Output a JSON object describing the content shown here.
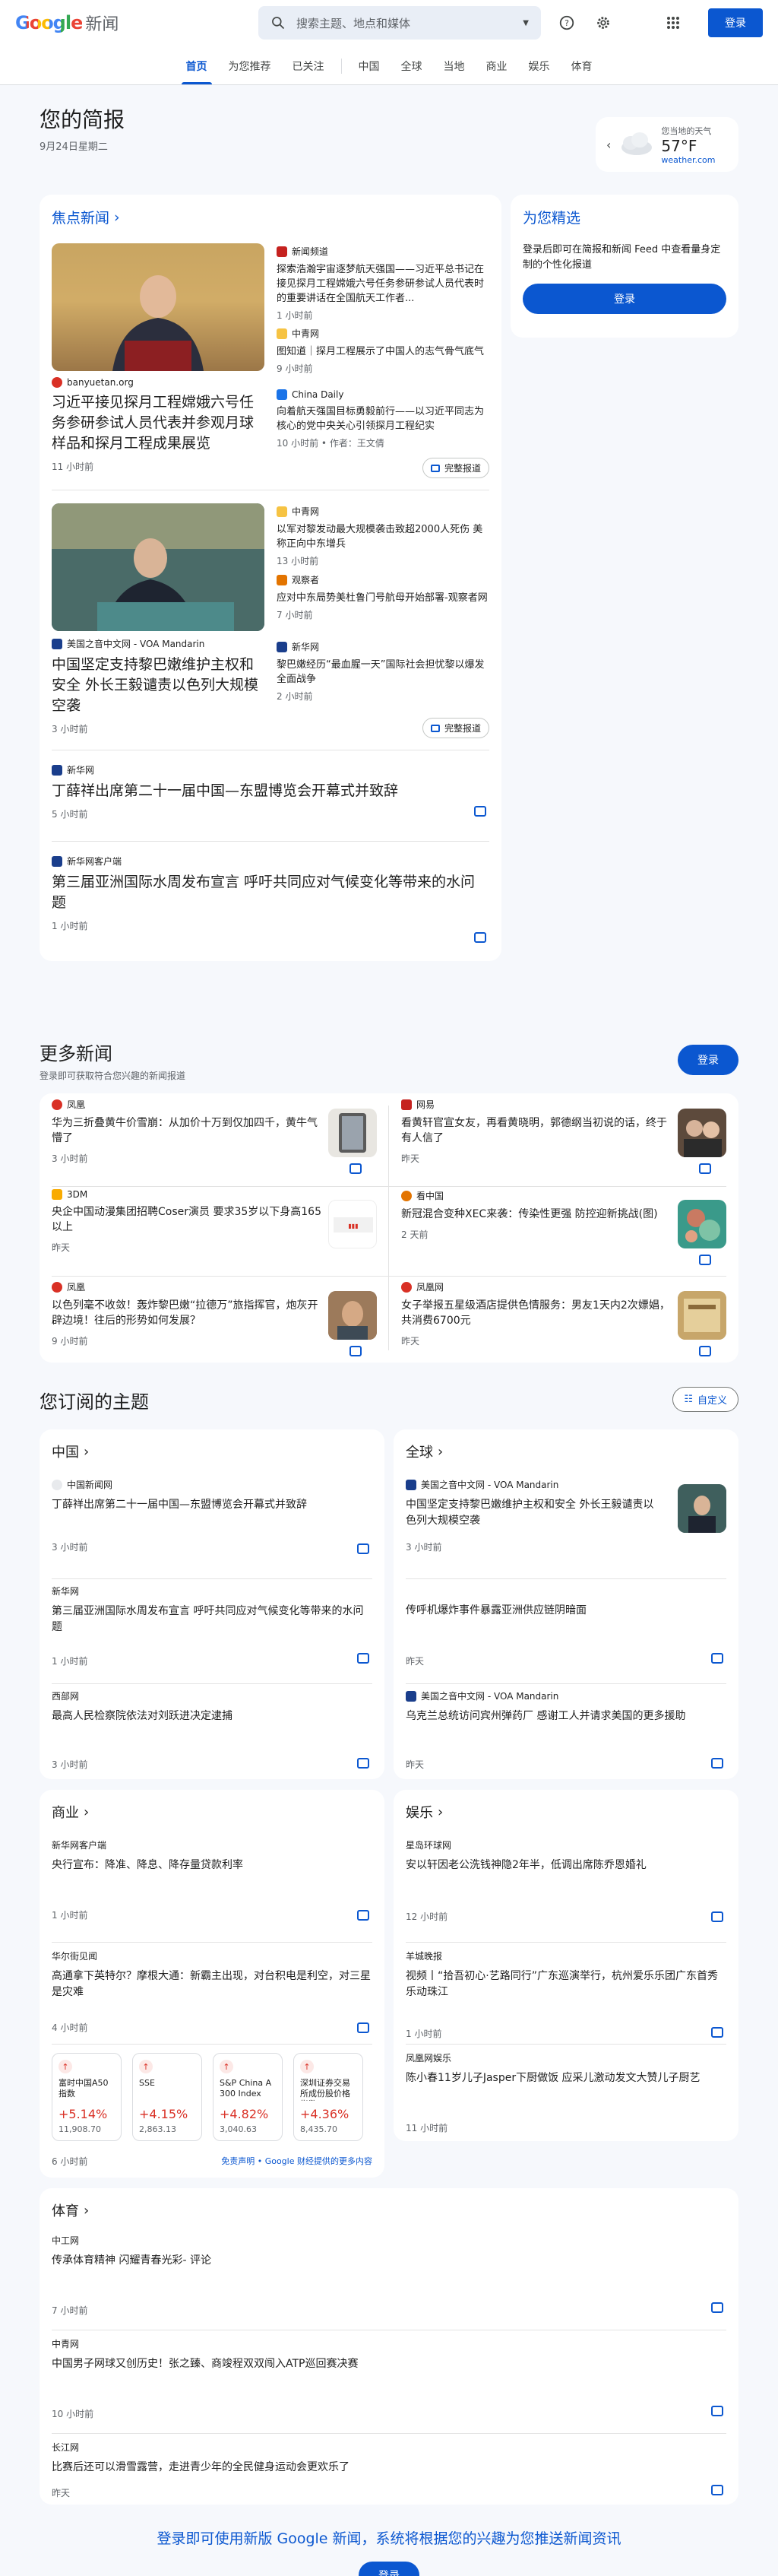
{
  "header": {
    "logo_google": "Google",
    "logo_news": "新闻",
    "search_placeholder": "搜索主题、地点和媒体",
    "signin": "登录"
  },
  "nav": {
    "tabs": [
      "首页",
      "为您推荐",
      "已关注"
    ],
    "topics": [
      "中国",
      "全球",
      "当地",
      "商业",
      "娱乐",
      "体育"
    ]
  },
  "brief": {
    "title": "您的简报",
    "date": "9月24日星期二"
  },
  "weather": {
    "label": "您当地的天气",
    "temp": "57°F",
    "source": "weather.com"
  },
  "top": {
    "title": "焦点新闻",
    "stories": [
      {
        "source": "banyuetan.org",
        "title": "习近平接见探月工程嫦娥六号任务参研参试人员代表并参观月球样品和探月工程成果展览",
        "time": "11 小时前",
        "side": [
          {
            "source": "新闻频道",
            "title": "探索浩瀚宇宙逐梦航天强国——习近平总书记在接见探月工程嫦娥六号任务参研参试人员代表时的重要讲话在全国航天工作者...",
            "time": "1 小时前"
          },
          {
            "source": "中青网",
            "title": "图知道｜探月工程展示了中国人的志气骨气底气",
            "time": "9 小时前"
          },
          {
            "source": "China Daily",
            "title": "向着航天强国目标勇毅前行——以习近平同志为核心的党中央关心引领探月工程纪实",
            "time": "10 小时前",
            "author": "作者：王文倩"
          }
        ]
      },
      {
        "source": "美国之音中文网 - VOA Mandarin",
        "title": "中国坚定支持黎巴嫩维护主权和安全 外长王毅谴责以色列大规模空袭",
        "time": "3 小时前",
        "side": [
          {
            "source": "中青网",
            "title": "以军对黎发动最大规模袭击致超2000人死伤 美称正向中东增兵",
            "time": "13 小时前"
          },
          {
            "source": "观察者",
            "title": "应对中东局势美杜鲁门号航母开始部署-观察者网",
            "time": "7 小时前"
          },
          {
            "source": "新华网",
            "title": "黎巴嫩经历“最血腥一天”国际社会担忧黎以爆发全面战争",
            "time": "2 小时前"
          }
        ]
      },
      {
        "source": "新华网",
        "title": "丁薛祥出席第二十一届中国—东盟博览会开幕式并致辞",
        "time": "5 小时前"
      },
      {
        "source": "新华网客户端",
        "title": "第三届亚洲国际水周发布宣言 呼吁共同应对气候变化等带来的水问题",
        "time": "1 小时前"
      }
    ],
    "full_coverage": "完整报道"
  },
  "picks": {
    "title": "为您精选",
    "text": "登录后即可在简报和新闻 Feed 中查看量身定制的个性化报道",
    "signin": "登录"
  },
  "more": {
    "title": "更多新闻",
    "subtitle": "登录即可获取符合您兴趣的新闻报道",
    "signin": "登录",
    "items": [
      {
        "source": "凤凰",
        "title": "华为三折叠黄牛价雪崩：从加价十万到仅加四千，黄牛气懵了",
        "time": "3 小时前"
      },
      {
        "source": "网易",
        "title": "看黄轩官宣女友，再看黄晓明，郭德纲当初说的话，终于有人信了",
        "time": "昨天"
      },
      {
        "source": "3DM",
        "title": "央企中国动漫集团招聘Coser演员 要求35岁以下身高165以上",
        "time": "昨天"
      },
      {
        "source": "看中国",
        "title": "新冠混合变种XEC来袭：传染性更强 防控迎新挑战(图)",
        "time": "2 天前"
      },
      {
        "source": "凤凰",
        "title": "以色列毫不收敛！轰炸黎巴嫩“拉德万”旅指挥官，炮灰开辟边境！往后的形势如何发展？",
        "time": "9 小时前"
      },
      {
        "source": "凤凰网",
        "title": "女子举报五星级酒店提供色情服务：男友1天内2次嫖娼，共消费6700元",
        "time": "昨天"
      }
    ]
  },
  "topics": {
    "title": "您订阅的主题",
    "customize": "自定义",
    "china": {
      "title": "中国",
      "items": [
        {
          "source": "中国新闻网",
          "title": "丁薛祥出席第二十一届中国—东盟博览会开幕式并致辞",
          "time": "3 小时前"
        },
        {
          "source": "新华网",
          "title": "第三届亚洲国际水周发布宣言 呼吁共同应对气候变化等带来的水问题",
          "time": "1 小时前"
        },
        {
          "source": "西部网",
          "title": "最高人民检察院依法对刘跃进决定逮捕",
          "time": "3 小时前"
        }
      ]
    },
    "world": {
      "title": "全球",
      "items": [
        {
          "source": "美国之音中文网 - VOA Mandarin",
          "title": "中国坚定支持黎巴嫩维护主权和安全 外长王毅谴责以色列大规模空袭",
          "time": "3 小时前"
        },
        {
          "source": "",
          "title": "传呼机爆炸事件暴露亚洲供应链阴暗面",
          "time": "昨天"
        },
        {
          "source": "美国之音中文网 - VOA Mandarin",
          "title": "乌克兰总统访问宾州弹药厂 感谢工人并请求美国的更多援助",
          "time": "昨天"
        }
      ]
    },
    "business": {
      "title": "商业",
      "items": [
        {
          "source": "新华网客户端",
          "title": "央行宣布：降准、降息、降存量贷款利率",
          "time": "1 小时前"
        },
        {
          "source": "华尔街见闻",
          "title": "高通拿下英特尔？摩根大通：新霸主出现，对台积电是利空，对三星是灾难",
          "time": "4 小时前"
        }
      ],
      "stocks": [
        {
          "name": "富时中国A50指数",
          "change": "+5.14%",
          "value": "11,908.70"
        },
        {
          "name": "SSE",
          "change": "+4.15%",
          "value": "2,863.13"
        },
        {
          "name": "S&P China A 300 Index (CNY)",
          "change": "+4.82%",
          "value": "3,040.63"
        },
        {
          "name": "深圳证券交易所成份股价格指数",
          "change": "+4.36%",
          "value": "8,435.70"
        }
      ],
      "stock_time": "6 小时前",
      "disclaimer": "免责声明 • Google 财经提供的更多内容"
    },
    "ent": {
      "title": "娱乐",
      "items": [
        {
          "source": "星岛环球网",
          "title": "安以轩因老公洗钱神隐2年半，低调出席陈乔恩婚礼",
          "time": "12 小时前"
        },
        {
          "source": "羊城晚报",
          "title": "视频丨“拾吾初心·艺路同行”广东巡演举行，杭州爱乐乐团广东首秀乐动珠江",
          "time": "1 小时前"
        },
        {
          "source": "凤凰网娱乐",
          "title": "陈小春11岁儿子Jasper下厨做饭 应采儿激动发文大赞儿子厨艺",
          "time": "11 小时前"
        }
      ]
    },
    "sports": {
      "title": "体育",
      "items": [
        {
          "source": "中工网",
          "title": "传承体育精神 闪耀青春光彩- 评论",
          "time": "7 小时前"
        },
        {
          "source": "中青网",
          "title": "中国男子网球又创历史！张之臻、商竣程双双闯入ATP巡回赛决赛",
          "time": "10 小时前"
        },
        {
          "source": "长江网",
          "title": "比赛后还可以滑雪露营，走进青少年的全民健身运动会更欢乐了",
          "time": "昨天"
        }
      ]
    }
  },
  "footer": {
    "title": "登录即可使用新版 Google 新闻，系统将根据您的兴趣为您推送新闻资讯",
    "signin": "登录"
  },
  "colors": {
    "accent": "#0b57d0",
    "up": "#d93025"
  }
}
